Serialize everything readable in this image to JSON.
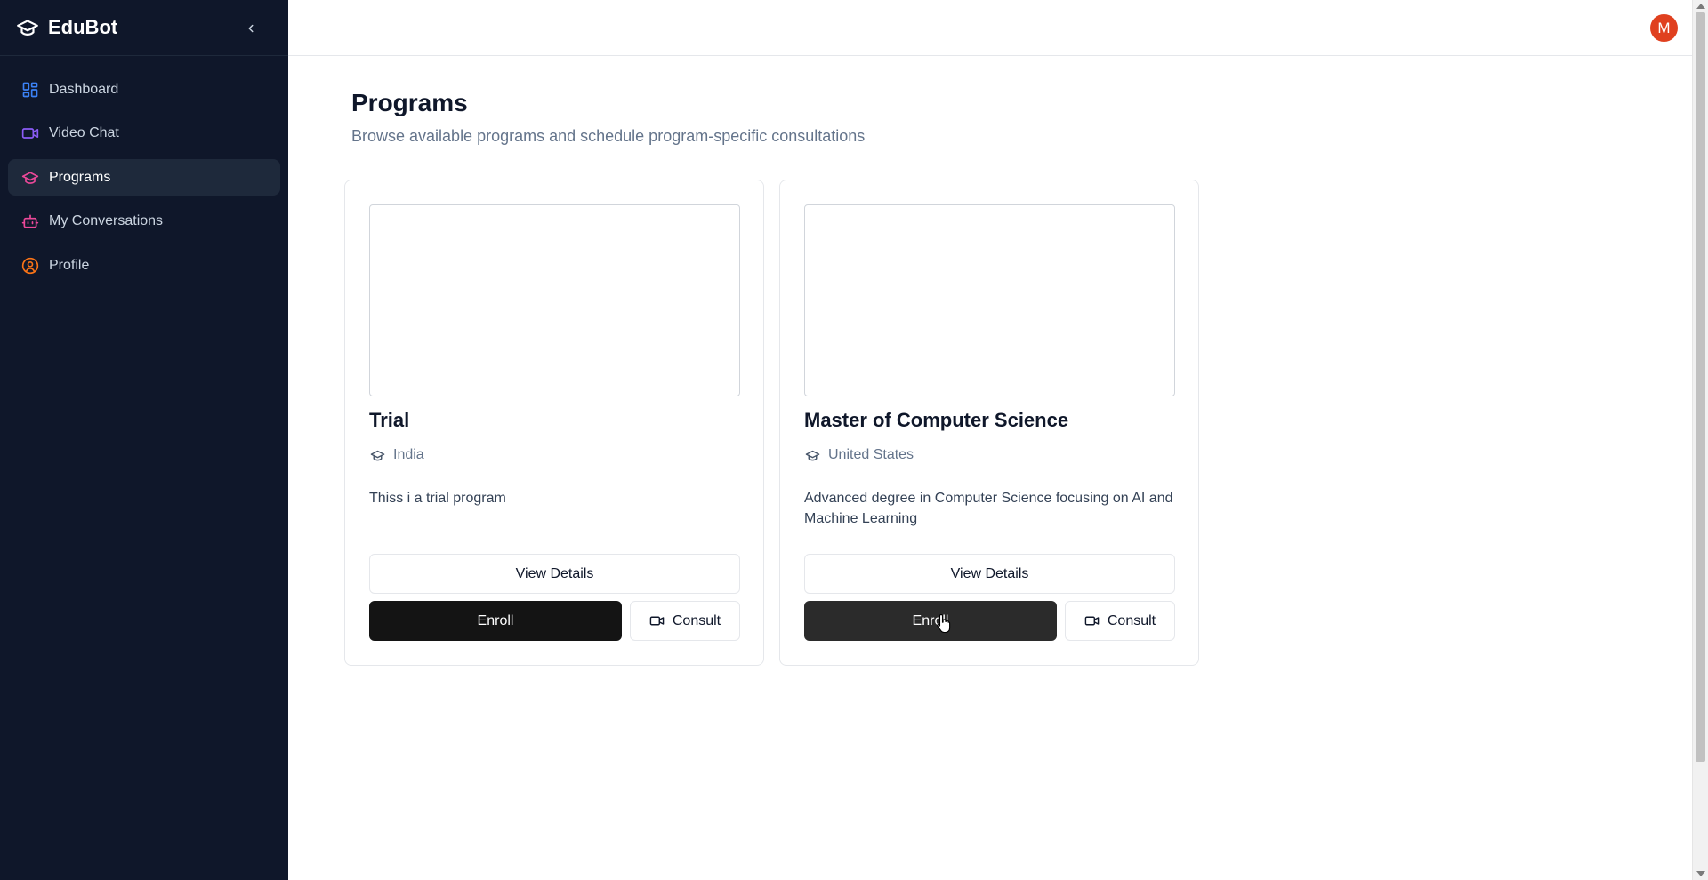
{
  "sidebar": {
    "brand": "EduBot",
    "items": [
      {
        "label": "Dashboard",
        "icon": "dashboard-icon",
        "color": "#3b82f6"
      },
      {
        "label": "Video Chat",
        "icon": "video-icon",
        "color": "#8b5cf6"
      },
      {
        "label": "Programs",
        "icon": "graduation-cap-icon",
        "color": "#ec4899",
        "active": true
      },
      {
        "label": "My Conversations",
        "icon": "bot-icon",
        "color": "#ec4899"
      },
      {
        "label": "Profile",
        "icon": "user-circle-icon",
        "color": "#f97316"
      }
    ]
  },
  "header": {
    "avatar_initial": "M",
    "avatar_color": "#e0401f"
  },
  "main": {
    "title": "Programs",
    "subtitle": "Browse available programs and schedule program-specific consultations"
  },
  "programs": [
    {
      "title": "Trial",
      "location": "India",
      "description": "Thiss i a trial program",
      "details_label": "View Details",
      "enroll_label": "Enroll",
      "consult_label": "Consult"
    },
    {
      "title": "Master of Computer Science",
      "location": "United States",
      "description": "Advanced degree in Computer Science focusing on AI and Machine Learning",
      "details_label": "View Details",
      "enroll_label": "Enroll",
      "consult_label": "Consult"
    }
  ]
}
